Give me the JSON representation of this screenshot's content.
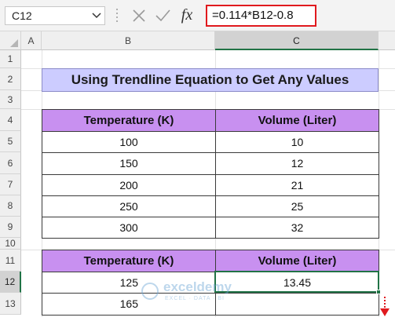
{
  "formula_bar": {
    "name_box": "C12",
    "fx_label": "fx",
    "formula": "=0.114*B12-0.8"
  },
  "columns": [
    "A",
    "B",
    "C"
  ],
  "rows": [
    "1",
    "2",
    "3",
    "4",
    "5",
    "6",
    "7",
    "8",
    "9",
    "10",
    "11",
    "12",
    "13"
  ],
  "title": "Using Trendline Equation to Get Any Values",
  "table1": {
    "headers": [
      "Temperature (K)",
      "Volume (Liter)"
    ],
    "rows": [
      [
        "100",
        "10"
      ],
      [
        "150",
        "12"
      ],
      [
        "200",
        "21"
      ],
      [
        "250",
        "25"
      ],
      [
        "300",
        "32"
      ]
    ]
  },
  "table2": {
    "headers": [
      "Temperature (K)",
      "Volume (Liter)"
    ],
    "rows": [
      [
        "125",
        "13.45"
      ],
      [
        "165",
        ""
      ]
    ]
  },
  "watermark": {
    "name": "exceldemy",
    "tagline": "EXCEL · DATA · BI"
  },
  "colors": {
    "header_fill": "#c890f0",
    "title_fill": "#ccccff",
    "formula_highlight": "#e0191e",
    "selection": "#217346"
  }
}
